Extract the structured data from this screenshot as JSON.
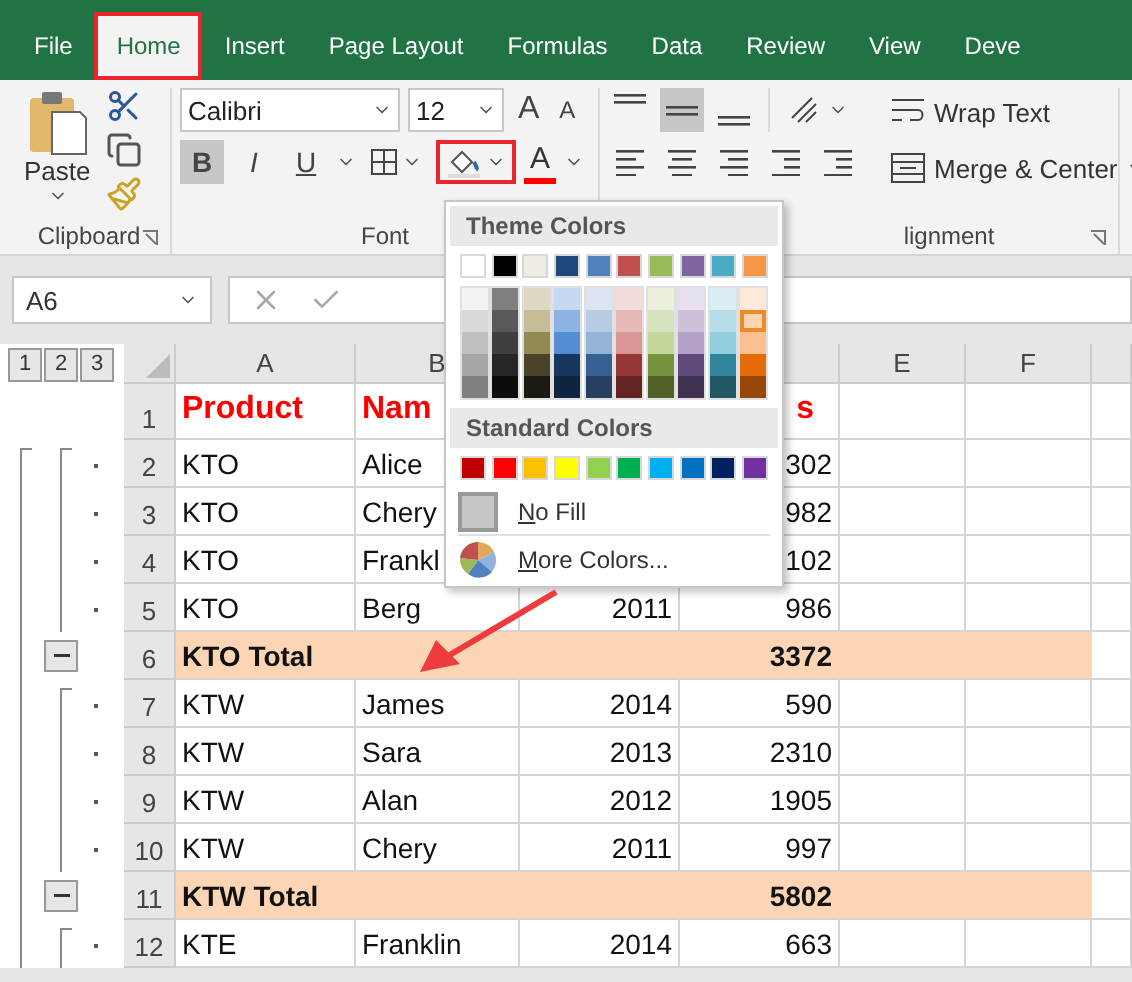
{
  "ribbon_tabs": [
    {
      "label": "File",
      "selected": false,
      "highlighted": false
    },
    {
      "label": "Home",
      "selected": true,
      "highlighted": true
    },
    {
      "label": "Insert",
      "selected": false,
      "highlighted": false
    },
    {
      "label": "Page Layout",
      "selected": false,
      "highlighted": false
    },
    {
      "label": "Formulas",
      "selected": false,
      "highlighted": false
    },
    {
      "label": "Data",
      "selected": false,
      "highlighted": false
    },
    {
      "label": "Review",
      "selected": false,
      "highlighted": false
    },
    {
      "label": "View",
      "selected": false,
      "highlighted": false
    },
    {
      "label": "Deve",
      "selected": false,
      "highlighted": false
    }
  ],
  "clipboard": {
    "paste_label": "Paste",
    "group_label": "Clipboard"
  },
  "font": {
    "name": "Calibri",
    "size": "12",
    "grow": "A",
    "shrink": "A",
    "styles": [
      {
        "label": "B",
        "kind": "bold",
        "on": true
      },
      {
        "label": "I",
        "kind": "italic",
        "on": false
      },
      {
        "label": "U",
        "kind": "underline",
        "on": false
      }
    ],
    "fill_highlighted": true,
    "font_color_label": "A",
    "group_label": "Font"
  },
  "alignment": {
    "vertical": [
      {
        "kind": "top",
        "on": false
      },
      {
        "kind": "middle",
        "on": true
      },
      {
        "kind": "bottom",
        "on": false
      }
    ],
    "wrap_text": "Wrap Text",
    "merge": "Merge & Center",
    "group_label": "lignment"
  },
  "formula_bar": {
    "name_box": "A6"
  },
  "outline_levels": [
    "1",
    "2",
    "3"
  ],
  "columns": [
    {
      "header": "A",
      "kind": "text"
    },
    {
      "header": "B",
      "kind": "text"
    },
    {
      "kind": "number"
    },
    {
      "kind": "number"
    },
    {
      "header": "E",
      "kind": "text"
    },
    {
      "header": "F",
      "kind": "text"
    }
  ],
  "rows": [
    {
      "number": "1",
      "kind": "header",
      "cells": [
        "Product",
        "Nam",
        null,
        "s",
        null,
        null
      ]
    },
    {
      "number": "2",
      "kind": "data",
      "cells": [
        "KTO",
        "Alice",
        null,
        "302",
        null,
        null
      ]
    },
    {
      "number": "3",
      "kind": "data",
      "cells": [
        "KTO",
        "Chery",
        null,
        "982",
        null,
        null
      ]
    },
    {
      "number": "4",
      "kind": "data",
      "cells": [
        "KTO",
        "Frankl",
        null,
        "102",
        null,
        null
      ]
    },
    {
      "number": "5",
      "kind": "data",
      "cells": [
        "KTO",
        "Berg",
        "2011",
        "986",
        null,
        null
      ]
    },
    {
      "number": "6",
      "kind": "total",
      "cells": [
        "KTO Total",
        null,
        null,
        "3372",
        null,
        null
      ]
    },
    {
      "number": "7",
      "kind": "data",
      "cells": [
        "KTW",
        "James",
        "2014",
        "590",
        null,
        null
      ]
    },
    {
      "number": "8",
      "kind": "data",
      "cells": [
        "KTW",
        "Sara",
        "2013",
        "2310",
        null,
        null
      ]
    },
    {
      "number": "9",
      "kind": "data",
      "cells": [
        "KTW",
        "Alan",
        "2012",
        "1905",
        null,
        null
      ]
    },
    {
      "number": "10",
      "kind": "data",
      "cells": [
        "KTW",
        "Chery",
        "2011",
        "997",
        null,
        null
      ]
    },
    {
      "number": "11",
      "kind": "total",
      "cells": [
        "KTW Total",
        null,
        null,
        "5802",
        null,
        null
      ]
    },
    {
      "number": "12",
      "kind": "data",
      "cells": [
        "KTE",
        "Franklin",
        "2014",
        "663",
        null,
        null
      ]
    }
  ],
  "fill_menu": {
    "theme_title": "Theme Colors",
    "standard_title": "Standard Colors",
    "no_fill": "No Fill",
    "more_colors": "More Colors...",
    "theme_colors": [
      {
        "color": "#ffffff",
        "selected": false,
        "shades": [
          {
            "color": "#f2f2f2",
            "selected": false
          },
          {
            "color": "#d9d9d9",
            "selected": false
          },
          {
            "color": "#bfbfbf",
            "selected": false
          },
          {
            "color": "#a6a6a6",
            "selected": false
          },
          {
            "color": "#808080",
            "selected": false
          }
        ]
      },
      {
        "color": "#000000",
        "selected": false,
        "shades": [
          {
            "color": "#7f7f7f",
            "selected": false
          },
          {
            "color": "#595959",
            "selected": false
          },
          {
            "color": "#3f3f3f",
            "selected": false
          },
          {
            "color": "#262626",
            "selected": false
          },
          {
            "color": "#0c0c0c",
            "selected": false
          }
        ]
      },
      {
        "color": "#eeece1",
        "selected": false,
        "shades": [
          {
            "color": "#ddd9c3",
            "selected": false
          },
          {
            "color": "#c4bd97",
            "selected": false
          },
          {
            "color": "#938953",
            "selected": false
          },
          {
            "color": "#494429",
            "selected": false
          },
          {
            "color": "#1d1b10",
            "selected": false
          }
        ]
      },
      {
        "color": "#1f497d",
        "selected": false,
        "shades": [
          {
            "color": "#c6d9f0",
            "selected": false
          },
          {
            "color": "#8db3e2",
            "selected": false
          },
          {
            "color": "#548dd4",
            "selected": false
          },
          {
            "color": "#17365d",
            "selected": false
          },
          {
            "color": "#0f243e",
            "selected": false
          }
        ]
      },
      {
        "color": "#4f81bd",
        "selected": false,
        "shades": [
          {
            "color": "#dbe5f1",
            "selected": false
          },
          {
            "color": "#b8cce4",
            "selected": false
          },
          {
            "color": "#95b3d7",
            "selected": false
          },
          {
            "color": "#366092",
            "selected": false
          },
          {
            "color": "#244061",
            "selected": false
          }
        ]
      },
      {
        "color": "#c0504d",
        "selected": false,
        "shades": [
          {
            "color": "#f2dcdb",
            "selected": false
          },
          {
            "color": "#e5b9b7",
            "selected": false
          },
          {
            "color": "#d99694",
            "selected": false
          },
          {
            "color": "#953734",
            "selected": false
          },
          {
            "color": "#632423",
            "selected": false
          }
        ]
      },
      {
        "color": "#9bbb59",
        "selected": false,
        "shades": [
          {
            "color": "#ebf1dd",
            "selected": false
          },
          {
            "color": "#d7e3bc",
            "selected": false
          },
          {
            "color": "#c3d69b",
            "selected": false
          },
          {
            "color": "#76923c",
            "selected": false
          },
          {
            "color": "#4f6128",
            "selected": false
          }
        ]
      },
      {
        "color": "#8064a2",
        "selected": false,
        "shades": [
          {
            "color": "#e5e0ec",
            "selected": false
          },
          {
            "color": "#ccc1d9",
            "selected": false
          },
          {
            "color": "#b2a2c7",
            "selected": false
          },
          {
            "color": "#5f497a",
            "selected": false
          },
          {
            "color": "#3f3151",
            "selected": false
          }
        ]
      },
      {
        "color": "#4bacc6",
        "selected": false,
        "shades": [
          {
            "color": "#dbeef3",
            "selected": false
          },
          {
            "color": "#b7dde8",
            "selected": false
          },
          {
            "color": "#92cddc",
            "selected": false
          },
          {
            "color": "#31859b",
            "selected": false
          },
          {
            "color": "#205867",
            "selected": false
          }
        ]
      },
      {
        "color": "#f79646",
        "selected": false,
        "shades": [
          {
            "color": "#fdeada",
            "selected": false
          },
          {
            "color": "#fbd5b5",
            "selected": true
          },
          {
            "color": "#fac08f",
            "selected": false
          },
          {
            "color": "#e36c09",
            "selected": false
          },
          {
            "color": "#974806",
            "selected": false
          }
        ]
      }
    ],
    "standard_colors": [
      {
        "color": "#c00000",
        "selected": false
      },
      {
        "color": "#ff0000",
        "selected": false
      },
      {
        "color": "#ffc000",
        "selected": false
      },
      {
        "color": "#ffff00",
        "selected": false
      },
      {
        "color": "#92d050",
        "selected": false
      },
      {
        "color": "#00b050",
        "selected": false
      },
      {
        "color": "#00b0f0",
        "selected": false
      },
      {
        "color": "#0070c0",
        "selected": false
      },
      {
        "color": "#002060",
        "selected": false
      },
      {
        "color": "#7030a0",
        "selected": false
      }
    ]
  }
}
